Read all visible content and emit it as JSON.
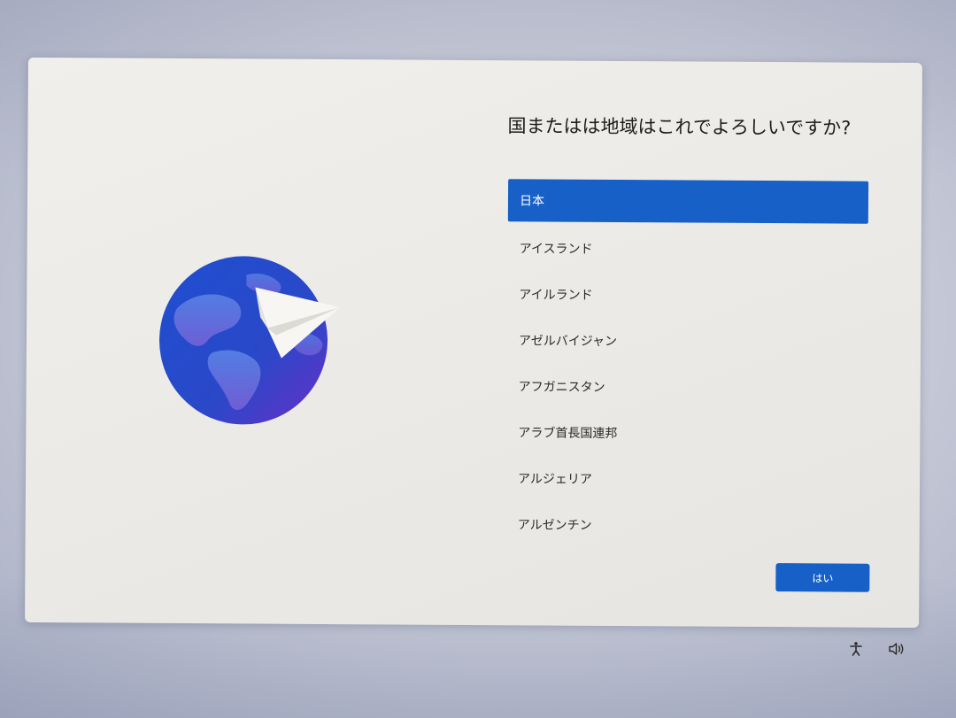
{
  "oobe": {
    "question": "国またはは地域はこれでよろしいですか?",
    "countries": [
      {
        "label": "日本",
        "selected": true
      },
      {
        "label": "アイスランド",
        "selected": false
      },
      {
        "label": "アイルランド",
        "selected": false
      },
      {
        "label": "アゼルバイジャン",
        "selected": false
      },
      {
        "label": "アフガニスタン",
        "selected": false
      },
      {
        "label": "アラブ首長国連邦",
        "selected": false
      },
      {
        "label": "アルジェリア",
        "selected": false
      },
      {
        "label": "アルゼンチン",
        "selected": false
      }
    ],
    "yes_button_label": "はい",
    "illustration": "globe-with-paper-plane"
  },
  "taskbar": {
    "icons": [
      "accessibility-icon",
      "volume-icon"
    ]
  },
  "colors": {
    "accent": "#1660c8",
    "window_background": "#eeece8",
    "text": "#1c1c1c"
  }
}
